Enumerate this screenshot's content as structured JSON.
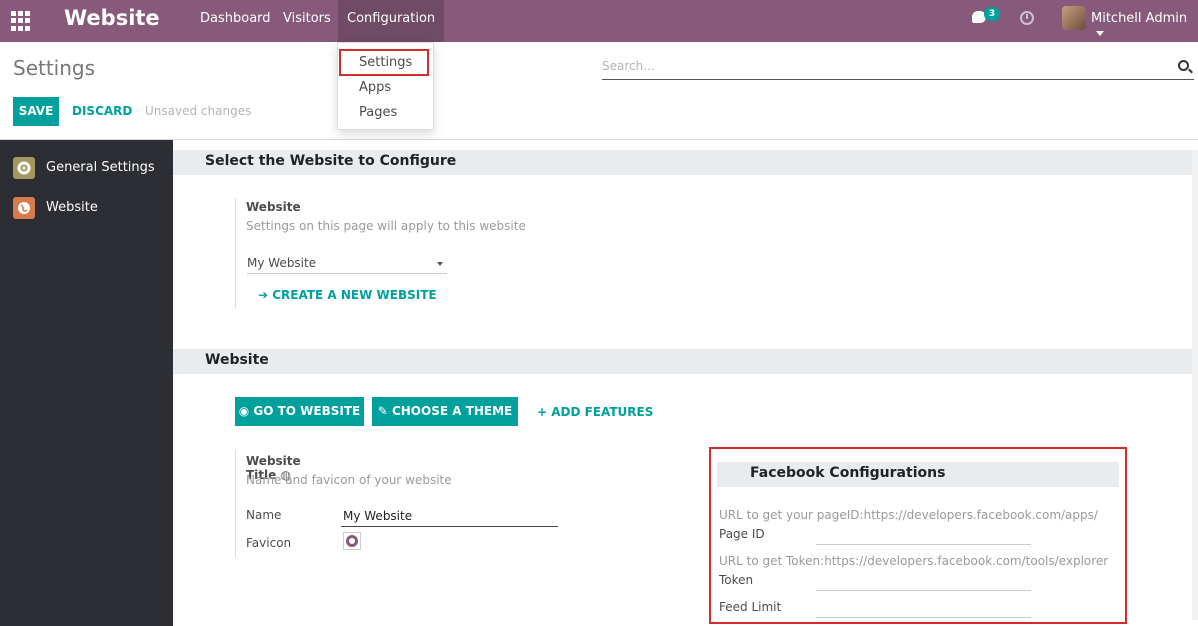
{
  "topbar": {
    "brand": "Website",
    "menu": [
      "Dashboard",
      "Visitors",
      "Configuration"
    ],
    "messages_badge": "3",
    "user": "Mitchell Admin"
  },
  "dropdown": {
    "items": [
      "Settings",
      "Apps",
      "Pages"
    ]
  },
  "control": {
    "breadcrumb": "Settings",
    "search_placeholder": "Search...",
    "save_label": "SAVE",
    "discard_label": "DISCARD",
    "unsaved_text": "Unsaved changes"
  },
  "sidebar": {
    "items": [
      {
        "label": "General Settings",
        "icon": "gear-icon",
        "color": "#a29860"
      },
      {
        "label": "Website",
        "icon": "globe-icon",
        "color": "#d77a4e"
      }
    ]
  },
  "section1": {
    "title": "Select the Website to Configure",
    "field_label": "Website",
    "field_help": "Settings on this page will apply to this website",
    "select_value": "My Website",
    "create_link": "CREATE A NEW WEBSITE"
  },
  "section2": {
    "title": "Website",
    "buttons": [
      "GO TO WEBSITE",
      "CHOOSE A THEME"
    ],
    "add_features": "ADD FEATURES",
    "title_label": "Website Title",
    "title_help": "Name and favicon of your website",
    "name_label": "Name",
    "name_value": "My Website",
    "favicon_label": "Favicon"
  },
  "facebook": {
    "title": "Facebook Configurations",
    "page_help": "URL to get your pageID:https://developers.facebook.com/apps/",
    "page_label": "Page ID",
    "token_help": "URL to get Token:https://developers.facebook.com/tools/explorer",
    "token_label": "Token",
    "feed_label": "Feed Limit"
  },
  "colors": {
    "topbar": "#875a7b",
    "accent": "#00a09d",
    "sidebar": "#2c2e33",
    "highlight": "#d62b2b"
  }
}
